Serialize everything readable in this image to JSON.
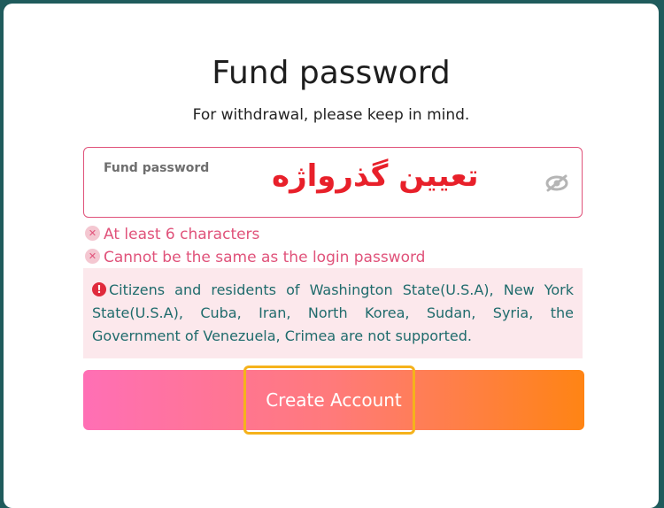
{
  "header": {
    "title": "Fund password",
    "subtitle": "For withdrawal, please keep in mind."
  },
  "password_field": {
    "label": "Fund password",
    "value": "",
    "overlay_text": "تعیین گذرواژه",
    "toggle_icon": "eye-slash-icon"
  },
  "rules": [
    {
      "icon": "close-icon",
      "text": "At least 6 characters"
    },
    {
      "icon": "close-icon",
      "text": "Cannot be the same as the login password"
    }
  ],
  "notice": {
    "icon": "alert-icon",
    "text": "Citizens and residents of Washington State(U.S.A), New York State(U.S.A), Cuba, Iran, North Korea, Sudan, Syria, the Government of Venezuela, Crimea are not supported."
  },
  "cta": {
    "label": "Create Account"
  },
  "colors": {
    "accent_pink": "#e0527a",
    "gradient_start": "#ff6fb5",
    "gradient_end": "#ff8414",
    "highlight": "#f5b21b"
  }
}
